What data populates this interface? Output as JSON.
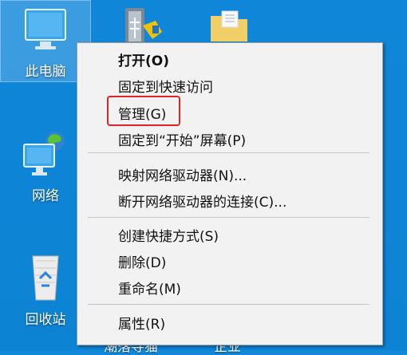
{
  "desktop": {
    "icons": [
      {
        "label": "此电脑"
      },
      {
        "label": "网络"
      },
      {
        "label": "回收站"
      }
    ],
    "partial_labels": {
      "left": "潮落导猫",
      "right": "企业"
    }
  },
  "context_menu": {
    "items": [
      {
        "label": "打开(O)"
      },
      {
        "label": "固定到快速访问"
      },
      {
        "label": "管理(G)"
      },
      {
        "label": "固定到“开始”屏幕(P)"
      },
      {
        "label": "映射网络驱动器(N)..."
      },
      {
        "label": "断开网络驱动器的连接(C)..."
      },
      {
        "label": "创建快捷方式(S)"
      },
      {
        "label": "删除(D)"
      },
      {
        "label": "重命名(M)"
      },
      {
        "label": "属性(R)"
      }
    ]
  }
}
